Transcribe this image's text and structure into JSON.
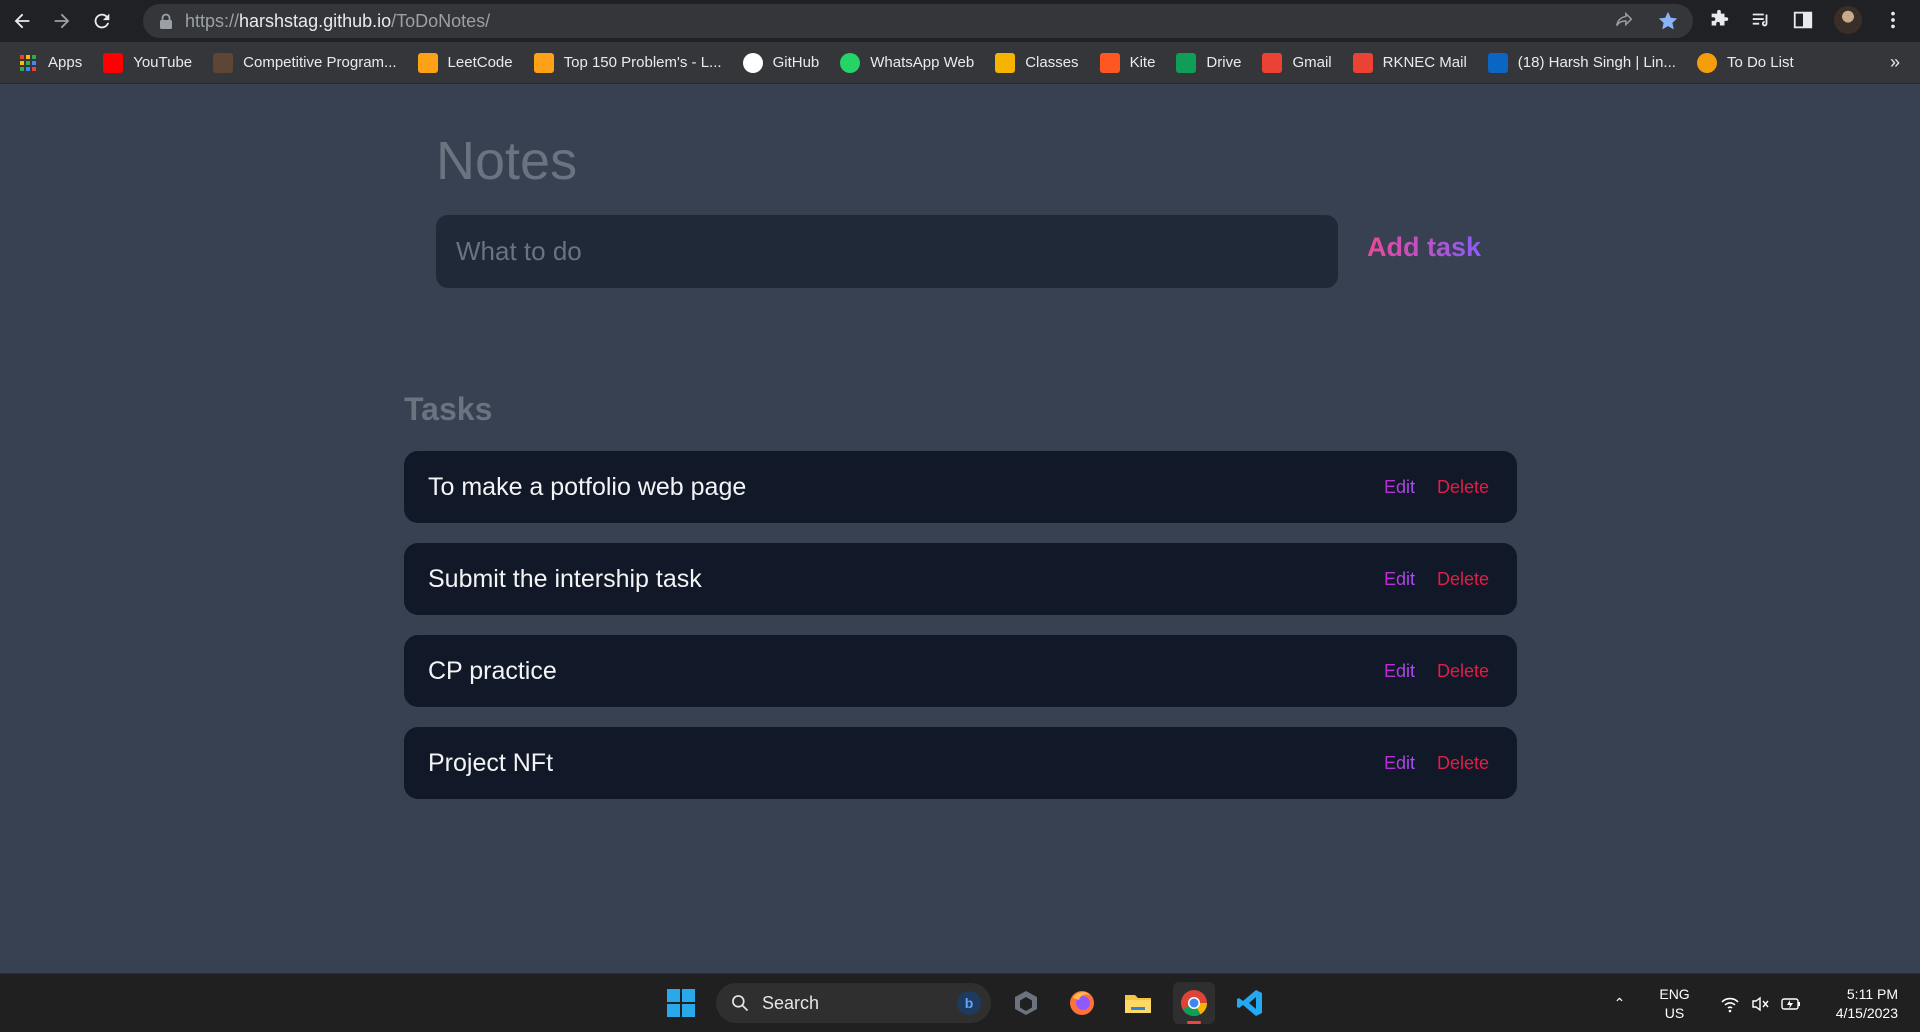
{
  "browser": {
    "url_scheme": "https://",
    "url_host": "harshstag.github.io",
    "url_path": "/ToDoNotes/",
    "bookmarks": [
      {
        "label": "Apps",
        "icon": "apps-grid-icon",
        "color": "#4285f4"
      },
      {
        "label": "YouTube",
        "icon": "youtube-icon",
        "color": "#ff0000"
      },
      {
        "label": "Competitive Program...",
        "icon": "codechef-icon",
        "color": "#5b4638"
      },
      {
        "label": "LeetCode",
        "icon": "leetcode-icon",
        "color": "#ffa116"
      },
      {
        "label": "Top 150 Problem's - L...",
        "icon": "leetcode-icon",
        "color": "#ffa116"
      },
      {
        "label": "GitHub",
        "icon": "github-icon",
        "color": "#ffffff"
      },
      {
        "label": "WhatsApp Web",
        "icon": "whatsapp-icon",
        "color": "#25d366"
      },
      {
        "label": "Classes",
        "icon": "classroom-icon",
        "color": "#f4b400"
      },
      {
        "label": "Kite",
        "icon": "kite-icon",
        "color": "#ff5722"
      },
      {
        "label": "Drive",
        "icon": "drive-icon",
        "color": "#0f9d58"
      },
      {
        "label": "Gmail",
        "icon": "gmail-icon",
        "color": "#ea4335"
      },
      {
        "label": "RKNEC Mail",
        "icon": "gmail-icon",
        "color": "#ea4335"
      },
      {
        "label": "(18) Harsh Singh | Lin...",
        "icon": "linkedin-icon",
        "color": "#0a66c2"
      },
      {
        "label": "To Do List",
        "icon": "todo-icon",
        "color": "#f59e0b"
      }
    ],
    "more_label": "»"
  },
  "app": {
    "title": "Notes",
    "input_placeholder": "What to do",
    "add_label": "Add task",
    "tasks_heading": "Tasks",
    "edit_label": "Edit",
    "delete_label": "Delete",
    "tasks": [
      {
        "text": "To make a potfolio web page"
      },
      {
        "text": "Submit the intership task"
      },
      {
        "text": "CP practice"
      },
      {
        "text": "Project NFt"
      }
    ]
  },
  "taskbar": {
    "search_label": "Search",
    "lang_line1": "ENG",
    "lang_line2": "US",
    "time": "5:11 PM",
    "date": "4/15/2023"
  },
  "colors": {
    "page_bg": "#374151",
    "card_bg": "#111827",
    "input_bg": "#1f2937",
    "edit": "#a855f7",
    "delete": "#e11d48"
  }
}
